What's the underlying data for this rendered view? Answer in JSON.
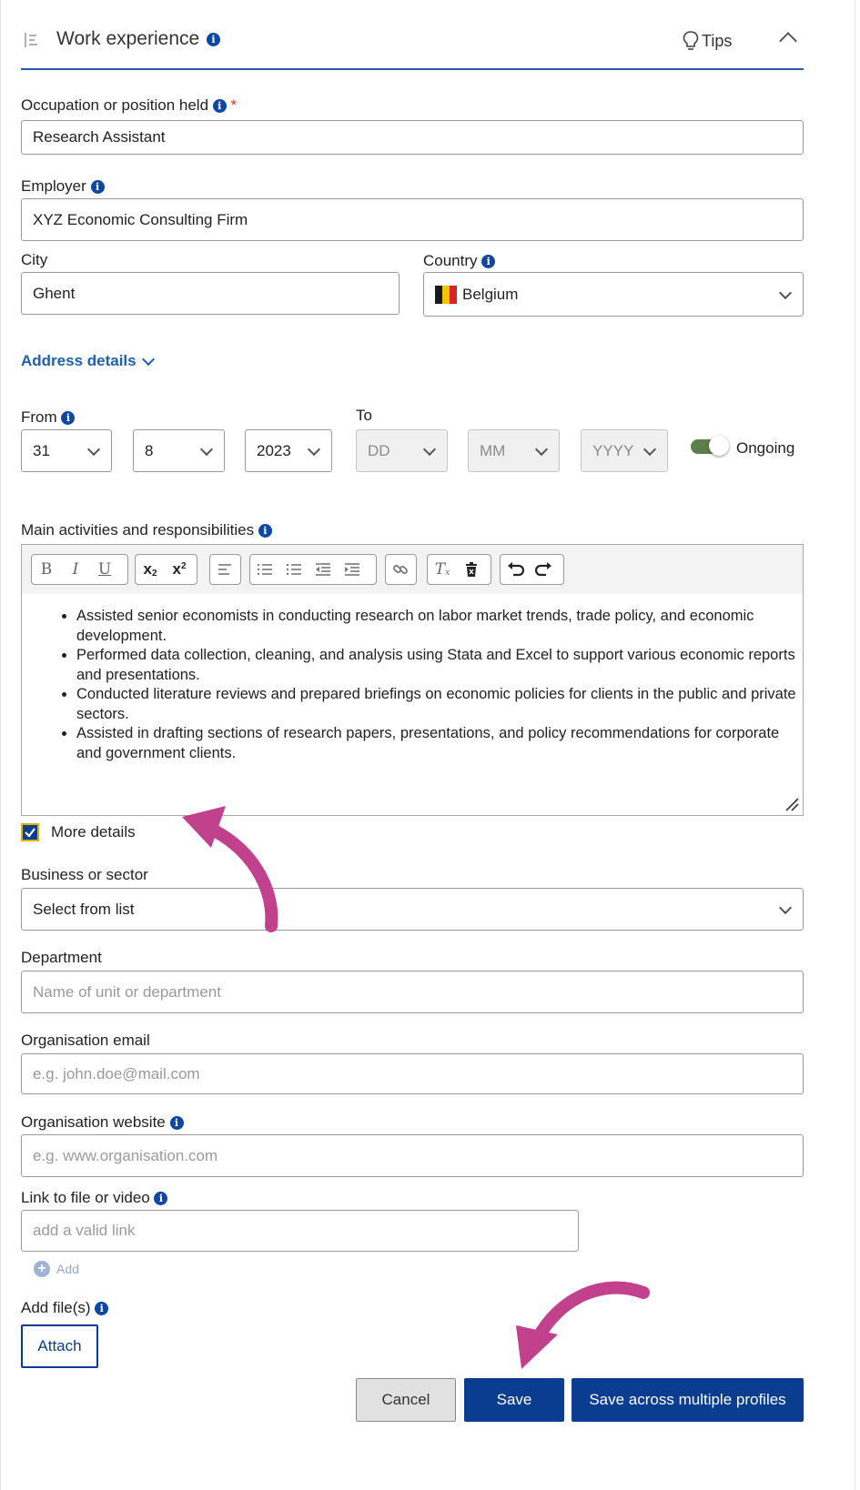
{
  "header": {
    "title": "Work experience",
    "tips_label": "Tips"
  },
  "occupation": {
    "label": "Occupation or position held",
    "required_mark": "*",
    "value": "Research Assistant"
  },
  "employer": {
    "label": "Employer",
    "value": "XYZ Economic Consulting Firm"
  },
  "city": {
    "label": "City",
    "value": "Ghent"
  },
  "country": {
    "label": "Country",
    "value": "Belgium"
  },
  "address_details": "Address details",
  "from": {
    "label": "From",
    "day": "31",
    "month": "8",
    "year": "2023"
  },
  "to": {
    "label": "To",
    "day": "DD",
    "month": "MM",
    "year": "YYYY"
  },
  "ongoing": {
    "label": "Ongoing",
    "on": true
  },
  "activities": {
    "label": "Main activities and responsibilities",
    "bullets": [
      "Assisted senior economists in conducting research on labor market trends, trade policy, and economic development.",
      "Performed data collection, cleaning, and analysis using Stata and Excel to support various economic reports and presentations.",
      "Conducted literature reviews and prepared briefings on economic policies for clients in the public and private sectors.",
      "Assisted in drafting sections of research papers, presentations, and policy recommendations for corporate and government clients."
    ]
  },
  "more_details": {
    "label": "More details",
    "checked": true
  },
  "business": {
    "label": "Business or sector",
    "value": "Select from list"
  },
  "department": {
    "label": "Department",
    "placeholder": "Name of unit or department"
  },
  "org_email": {
    "label": "Organisation email",
    "placeholder": "e.g. john.doe@mail.com"
  },
  "org_website": {
    "label": "Organisation website",
    "placeholder": "e.g. www.organisation.com"
  },
  "link": {
    "label": "Link to file or video",
    "placeholder": "add a valid link",
    "add_label": "Add"
  },
  "files": {
    "label": "Add file(s)",
    "attach_label": "Attach"
  },
  "footer": {
    "cancel": "Cancel",
    "save": "Save",
    "save_multi": "Save across multiple profiles"
  },
  "colors": {
    "primary": "#0a3d8f",
    "accent_arrow": "#c2418c",
    "toggle": "#5c7f4a",
    "required": "#d32f2f"
  }
}
